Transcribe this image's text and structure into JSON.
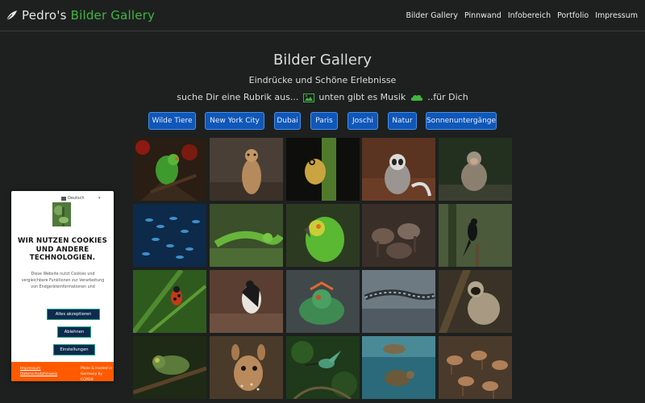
{
  "header": {
    "brand_plain": "Pedro's",
    "brand_accent": "Bilder Gallery",
    "logo_icon": "leaf-icon",
    "nav": [
      "Bilder Gallery",
      "Pinnwand",
      "Infobereich",
      "Portfolio",
      "Impressum"
    ]
  },
  "hero": {
    "title": "Bilder Gallery",
    "subtitle": "Eindrücke und Schöne Erlebnisse",
    "line_before": "suche Dir eine Rubrik aus...",
    "line_middle": "unten gibt es Musik",
    "line_after": "..für Dich",
    "image_icon": "image-icon",
    "music_icon": "cloud-icon"
  },
  "categories": [
    "Wilde Tiere",
    "New York City",
    "Dubai",
    "Paris",
    "Joschi",
    "Natur",
    "Sonnenuntergänge"
  ],
  "gallery": {
    "images": [
      "parrot",
      "meerkat",
      "frog",
      "lemur",
      "monkey",
      "fish-school",
      "lizard",
      "green-parrot",
      "horses",
      "black-bird",
      "bug",
      "cormorant",
      "iguana",
      "gecko",
      "langur",
      "chameleon",
      "fawn",
      "hummingbird",
      "turtle",
      "deer-herd"
    ]
  },
  "cookie": {
    "language": "Deutsch",
    "title": "WIR NUTZEN COOKIES UND ANDERE TECHNOLOGIEN.",
    "description": "Diese Website nutzt Cookies und vergleichbare Funktionen zur Verarbeitung von Endgeräteinformationen und",
    "accept_all": "Alles akzeptieren",
    "reject": "Ablehnen",
    "settings": "Einstellungen",
    "links": [
      "Impressum",
      "Datenschutzhinweis"
    ],
    "made_in": "Made & Hosted in Germany by CCM19"
  },
  "colors": {
    "background": "#1d201f",
    "accent_green": "#3fb63f",
    "button_blue": "#0f57b8",
    "cookie_footer": "#ff5a00"
  }
}
